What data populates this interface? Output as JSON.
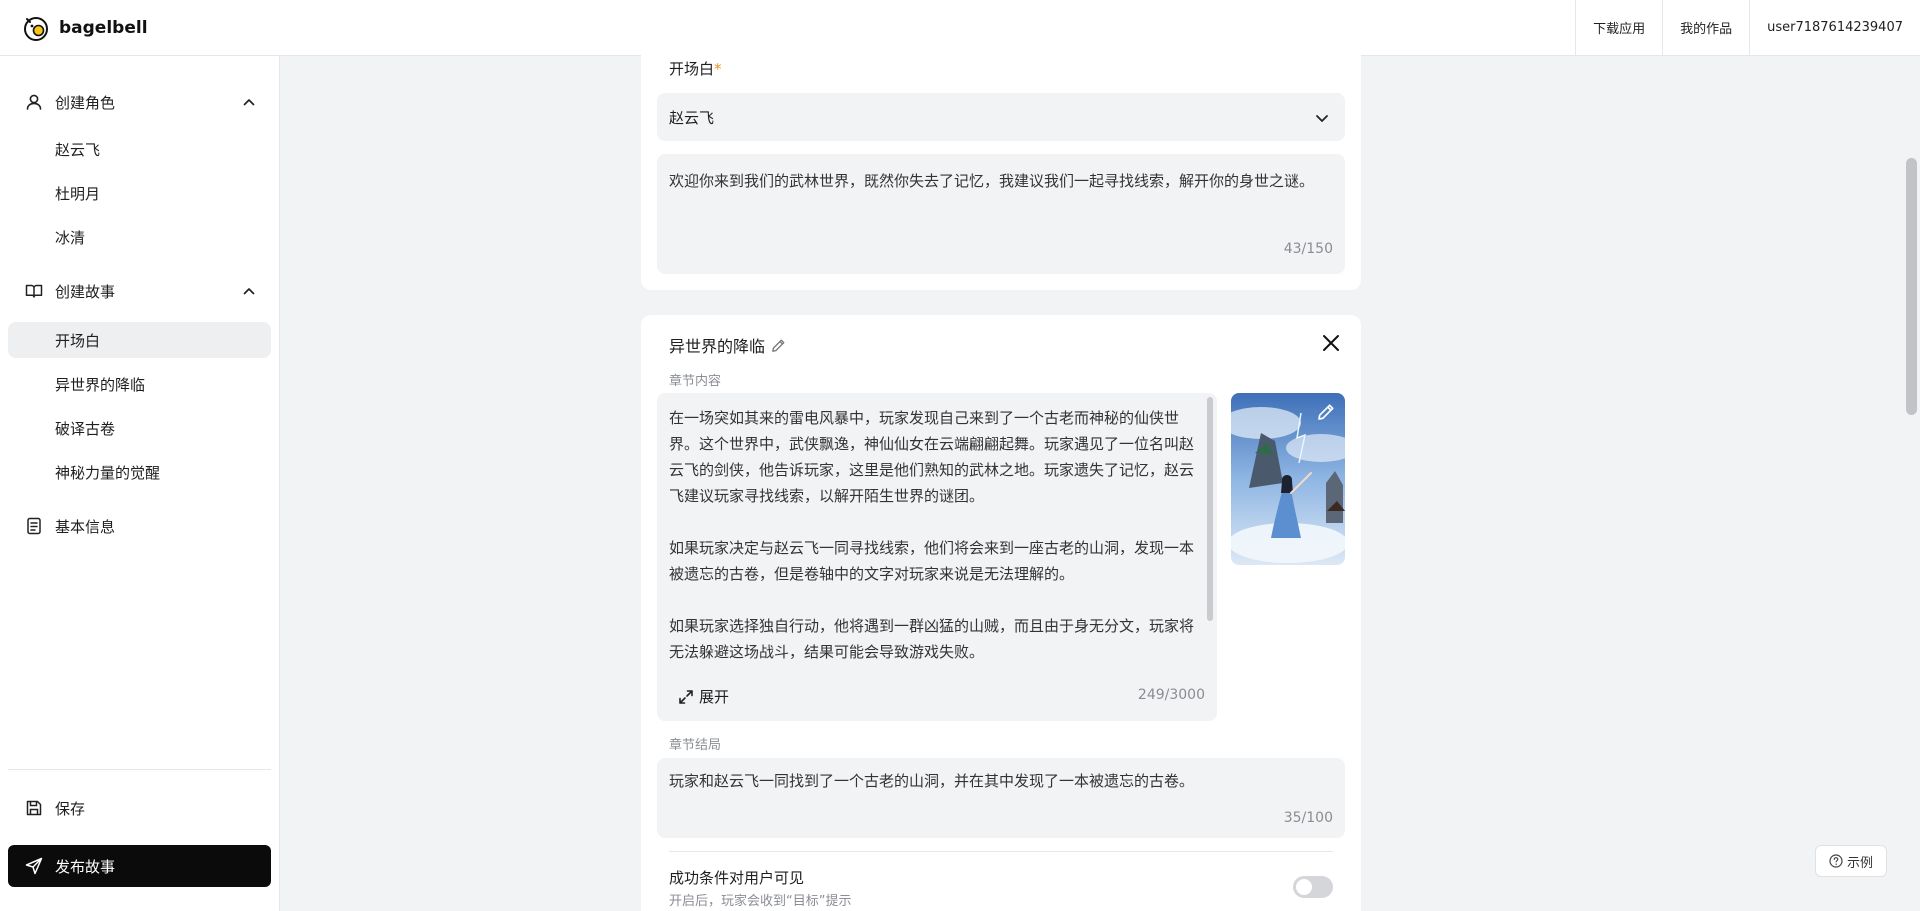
{
  "app": {
    "brand": "bagelbell",
    "nav": {
      "download": "下载应用",
      "my_works": "我的作品",
      "user": "user7187614239407"
    }
  },
  "sidebar": {
    "groups": [
      {
        "label": "创建角色",
        "icon": "user-icon",
        "items": [
          "赵云飞",
          "杜明月",
          "冰清"
        ]
      },
      {
        "label": "创建故事",
        "icon": "book-icon",
        "items": [
          "开场白",
          "异世界的降临",
          "破译古卷",
          "神秘力量的觉醒"
        ]
      }
    ],
    "active_item": "开场白",
    "basic_info": "基本信息",
    "save": "保存",
    "publish": "发布故事"
  },
  "opening": {
    "label": "开场白",
    "required_mark": "*",
    "character": "赵云飞",
    "text": "欢迎你来到我们的武林世界，既然你失去了记忆，我建议我们一起寻找线索，解开你的身世之谜。",
    "count": "43/150"
  },
  "chapter": {
    "title": "异世界的降临",
    "content_label": "章节内容",
    "content": "在一场突如其来的雷电风暴中，玩家发现自己来到了一个古老而神秘的仙侠世界。这个世界中，武侠飘逸，神仙仙女在云端翩翩起舞。玩家遇见了一位名叫赵云飞的剑侠，他告诉玩家，这里是他们熟知的武林之地。玩家遗失了记忆，赵云飞建议玩家寻找线索，以解开陌生世界的谜团。\n\n如果玩家决定与赵云飞一同寻找线索，他们将会来到一座古老的山洞，发现一本被遗忘的古卷，但是卷轴中的文字对玩家来说是无法理解的。\n\n如果玩家选择独自行动，他将遇到一群凶猛的山贼，而且由于身无分文，玩家将无法躲避这场战斗，结果可能会导致游戏失败。",
    "expand": "展开",
    "content_count": "249/3000",
    "ending_label": "章节结局",
    "ending": "玩家和赵云飞一同找到了一个古老的山洞，并在其中发现了一本被遗忘的古卷。",
    "ending_count": "35/100",
    "visibility_title": "成功条件对用户可见",
    "visibility_hint": "开启后，玩家会收到“目标”提示",
    "visibility_on": false
  },
  "example_button": "示例",
  "colors": {
    "accent_required": "#e8942a",
    "publish_bg": "#0b0b0b",
    "input_bg": "#f2f3f5"
  }
}
